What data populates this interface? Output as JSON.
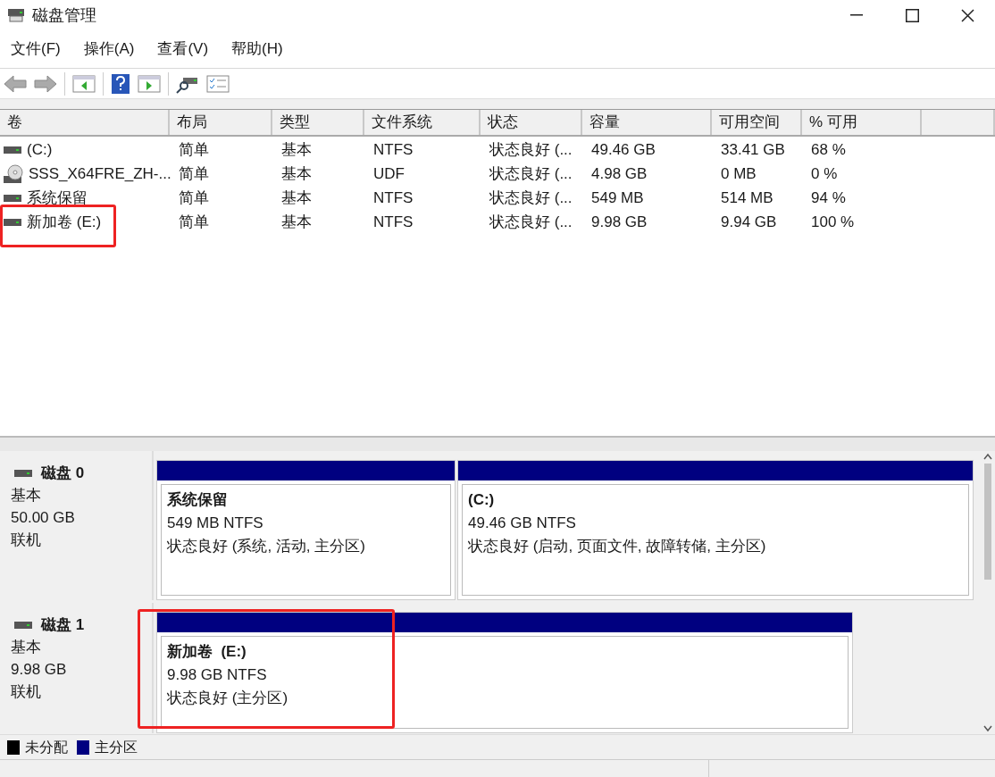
{
  "window": {
    "title": "磁盘管理"
  },
  "menu": [
    "文件(F)",
    "操作(A)",
    "查看(V)",
    "帮助(H)"
  ],
  "volume_table": {
    "columns": [
      "卷",
      "布局",
      "类型",
      "文件系统",
      "状态",
      "容量",
      "可用空间",
      "% 可用"
    ],
    "rows": [
      {
        "kind": "drive",
        "highlighted": false,
        "cells": [
          "(C:)",
          "简单",
          "基本",
          "NTFS",
          "状态良好 (...",
          "49.46 GB",
          "33.41 GB",
          "68 %"
        ]
      },
      {
        "kind": "disc",
        "highlighted": false,
        "cells": [
          "SSS_X64FRE_ZH-...",
          "简单",
          "基本",
          "UDF",
          "状态良好 (...",
          "4.98 GB",
          "0 MB",
          "0 %"
        ]
      },
      {
        "kind": "drive",
        "highlighted": false,
        "cells": [
          "系统保留",
          "简单",
          "基本",
          "NTFS",
          "状态良好 (...",
          "549 MB",
          "514 MB",
          "94 %"
        ]
      },
      {
        "kind": "drive",
        "highlighted": true,
        "cells": [
          "新加卷 (E:)",
          "简单",
          "基本",
          "NTFS",
          "状态良好 (...",
          "9.98 GB",
          "9.94 GB",
          "100 %"
        ]
      }
    ]
  },
  "disks": [
    {
      "name": "磁盘 0",
      "type": "基本",
      "size": "50.00 GB",
      "status": "联机",
      "partitions": [
        {
          "name": "系统保留",
          "size": "549 MB NTFS",
          "status": "状态良好 (系统, 活动, 主分区)",
          "highlighted": false
        },
        {
          "name": "(C:)",
          "size": "49.46 GB NTFS",
          "status": "状态良好 (启动, 页面文件, 故障转储, 主分区)",
          "highlighted": false
        }
      ]
    },
    {
      "name": "磁盘 1",
      "type": "基本",
      "size": "9.98 GB",
      "status": "联机",
      "partitions": [
        {
          "name": "新加卷  (E:)",
          "size": "9.98 GB NTFS",
          "status": "状态良好 (主分区)",
          "highlighted": true
        }
      ]
    }
  ],
  "legend": [
    {
      "label": "未分配",
      "color": "#000000"
    },
    {
      "label": "主分区",
      "color": "#000080"
    }
  ]
}
